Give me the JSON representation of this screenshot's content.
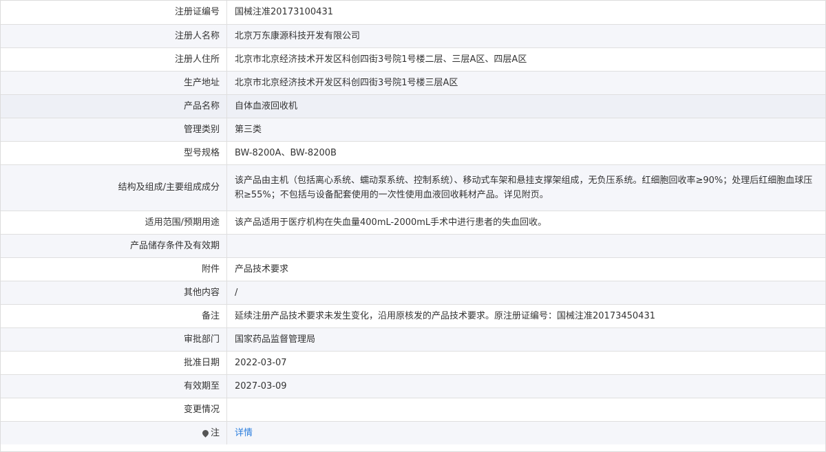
{
  "rows": [
    {
      "label": "注册证编号",
      "value": "国械注准20173100431"
    },
    {
      "label": "注册人名称",
      "value": "北京万东康源科技开发有限公司"
    },
    {
      "label": "注册人住所",
      "value": "北京市北京经济技术开发区科创四街3号院1号楼二层、三层A区、四层A区"
    },
    {
      "label": "生产地址",
      "value": "北京市北京经济技术开发区科创四街3号院1号楼三层A区"
    },
    {
      "label": "产品名称",
      "value": "自体血液回收机"
    },
    {
      "label": "管理类别",
      "value": "第三类"
    },
    {
      "label": "型号规格",
      "value": "BW-8200A、BW-8200B"
    },
    {
      "label": "结构及组成/主要组成成分",
      "value": "该产品由主机（包括离心系统、蠕动泵系统、控制系统）、移动式车架和悬挂支撑架组成，无负压系统。红细胞回收率≥90%；处理后红细胞血球压积≥55%；不包括与设备配套使用的一次性使用血液回收耗材产品。详见附页。"
    },
    {
      "label": "适用范围/预期用途",
      "value": "该产品适用于医疗机构在失血量400mL-2000mL手术中进行患者的失血回收。"
    },
    {
      "label": "产品储存条件及有效期",
      "value": ""
    },
    {
      "label": "附件",
      "value": "产品技术要求"
    },
    {
      "label": "其他内容",
      "value": "/"
    },
    {
      "label": "备注",
      "value": "延续注册产品技术要求未发生变化，沿用原核发的产品技术要求。原注册证编号：国械注准20173450431"
    },
    {
      "label": "审批部门",
      "value": "国家药品监督管理局"
    },
    {
      "label": "批准日期",
      "value": "2022-03-07"
    },
    {
      "label": "有效期至",
      "value": "2027-03-09"
    },
    {
      "label": "变更情况",
      "value": ""
    }
  ],
  "note": {
    "icon": "pin-icon",
    "label": "注",
    "link_text": "详情"
  },
  "colors": {
    "alt_row": "#f5f6fa",
    "highlight_row": "#eef0f6",
    "link": "#2a7ddd",
    "border": "#dfdfdf"
  }
}
